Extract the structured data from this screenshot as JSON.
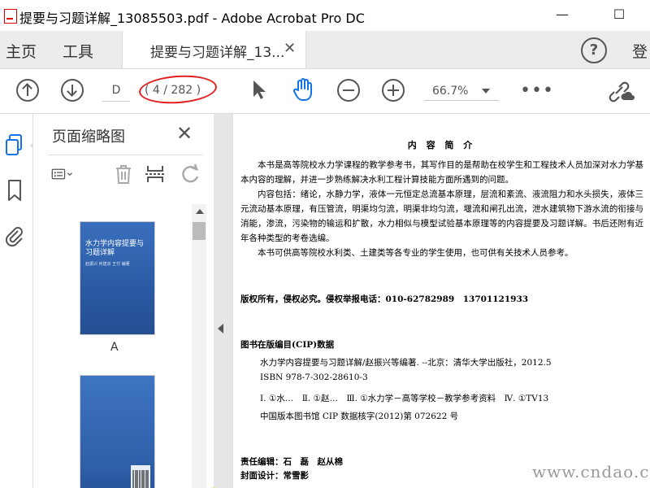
{
  "window": {
    "title": "提要与习题详解_13085503.pdf - Adobe Acrobat Pro DC",
    "minimize": "—",
    "maximize": "☐"
  },
  "menu": {
    "home": "主页",
    "tools": "工具",
    "doc_tab": "提要与习题详解_13...",
    "doc_tab_close": "✕",
    "help": "?",
    "login": "登"
  },
  "toolbar": {
    "page_input": "D",
    "page_count": "( 4 / 282 )",
    "zoom": "66.7%",
    "more": "•••"
  },
  "panel": {
    "title": "页面缩略图",
    "close": "✕",
    "thumb1_label": "A",
    "cover_title": "水力学内容提要与习题详解",
    "cover_sub": "赵振兴 何建京 王忖 编著"
  },
  "page": {
    "heading": "内 容 简 介",
    "intro": "本书是高等院校水力学课程的教学参考书，其写作目的是帮助在校学生和工程技术人员加深对水力学基本内容的理解，并进一步熟练解决水利工程计算技能方面所遇到的问题。",
    "content": "内容包括：绪论，水静力学，液体一元恒定总流基本原理，层流和紊流、液流阻力和水头损失，液体三元流动基本原理，有压管流，明渠均匀流，明渠非均匀流，堰流和闸孔出流，泄水建筑物下游水流的衔接与消能，渗流，污染物的输运和扩散，水力相似与模型试验基本原理等的内容提要及习题详解。书后还附有近年各种类型的考卷选编。",
    "audience": "本书可供高等院校水利类、土建类等各专业的学生使用，也可供有关技术人员参考。",
    "copyright": "版权所有，侵权必究。侵权举报电话：010-62782989　13701121933",
    "cip_heading": "图书在版编目(CIP)数据",
    "cip_line1": "水力学内容提要与习题详解/赵振兴等编著. --北京：清华大学出版社，2012.5",
    "cip_isbn": "ISBN 978-7-302-28610-3",
    "cip_class": "Ⅰ. ①水…　Ⅱ. ①赵…　Ⅲ. ①水力学－高等学校－教学参考资料　Ⅳ. ①TV13",
    "cip_number": "中国版本图书馆 CIP 数据核字(2012)第 072622 号",
    "editor": "责任编辑：石　磊　赵从棉",
    "cover_design": "封面设计：常雪影"
  },
  "watermark": "www.cndao.com",
  "colors": {
    "accent_blue": "#1473e6",
    "annotation_red": "#e02020",
    "cover_blue": "#2b5fa8"
  }
}
